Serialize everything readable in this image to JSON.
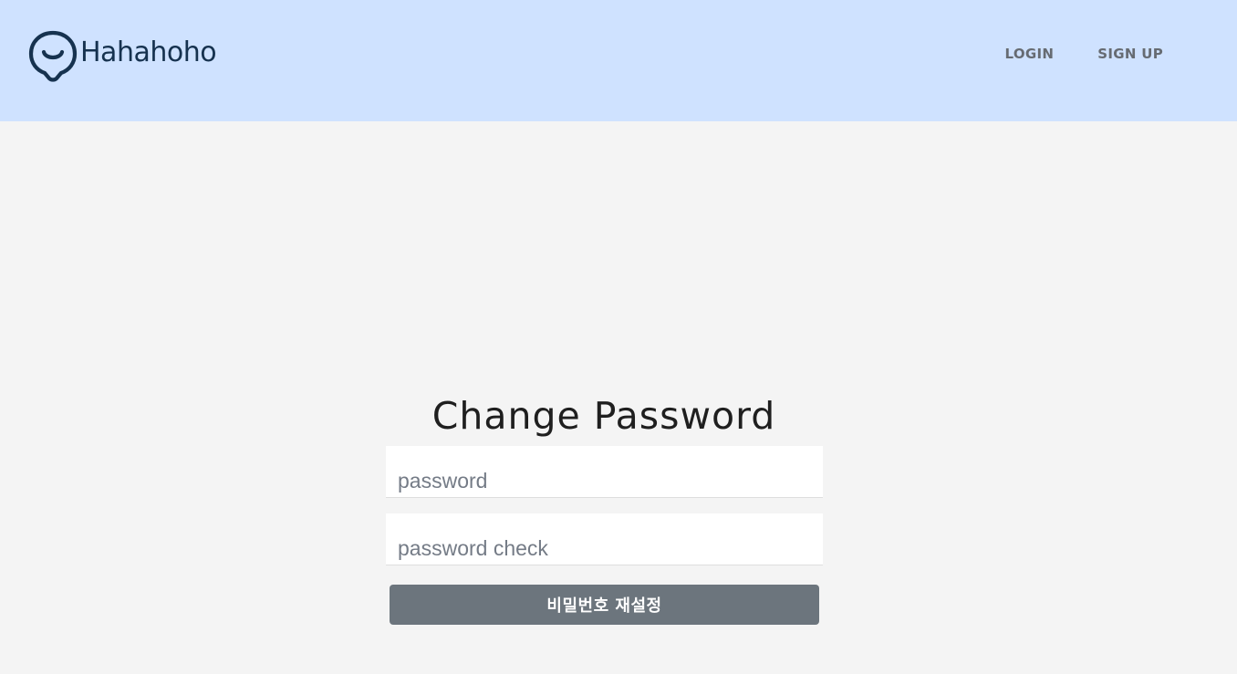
{
  "header": {
    "brand": "Hahahoho",
    "logo_icon": "speech-bubble-smile-icon",
    "bg_color": "#cfe2ff",
    "brand_color": "#16324f",
    "nav": {
      "login": "LOGIN",
      "signup": "SIGN UP"
    }
  },
  "form": {
    "title": "Change Password",
    "password": {
      "value": "",
      "placeholder": "password"
    },
    "password_check": {
      "value": "",
      "placeholder": "password check"
    },
    "submit_label": "비밀번호 재설정",
    "submit_color": "#6c757d"
  }
}
